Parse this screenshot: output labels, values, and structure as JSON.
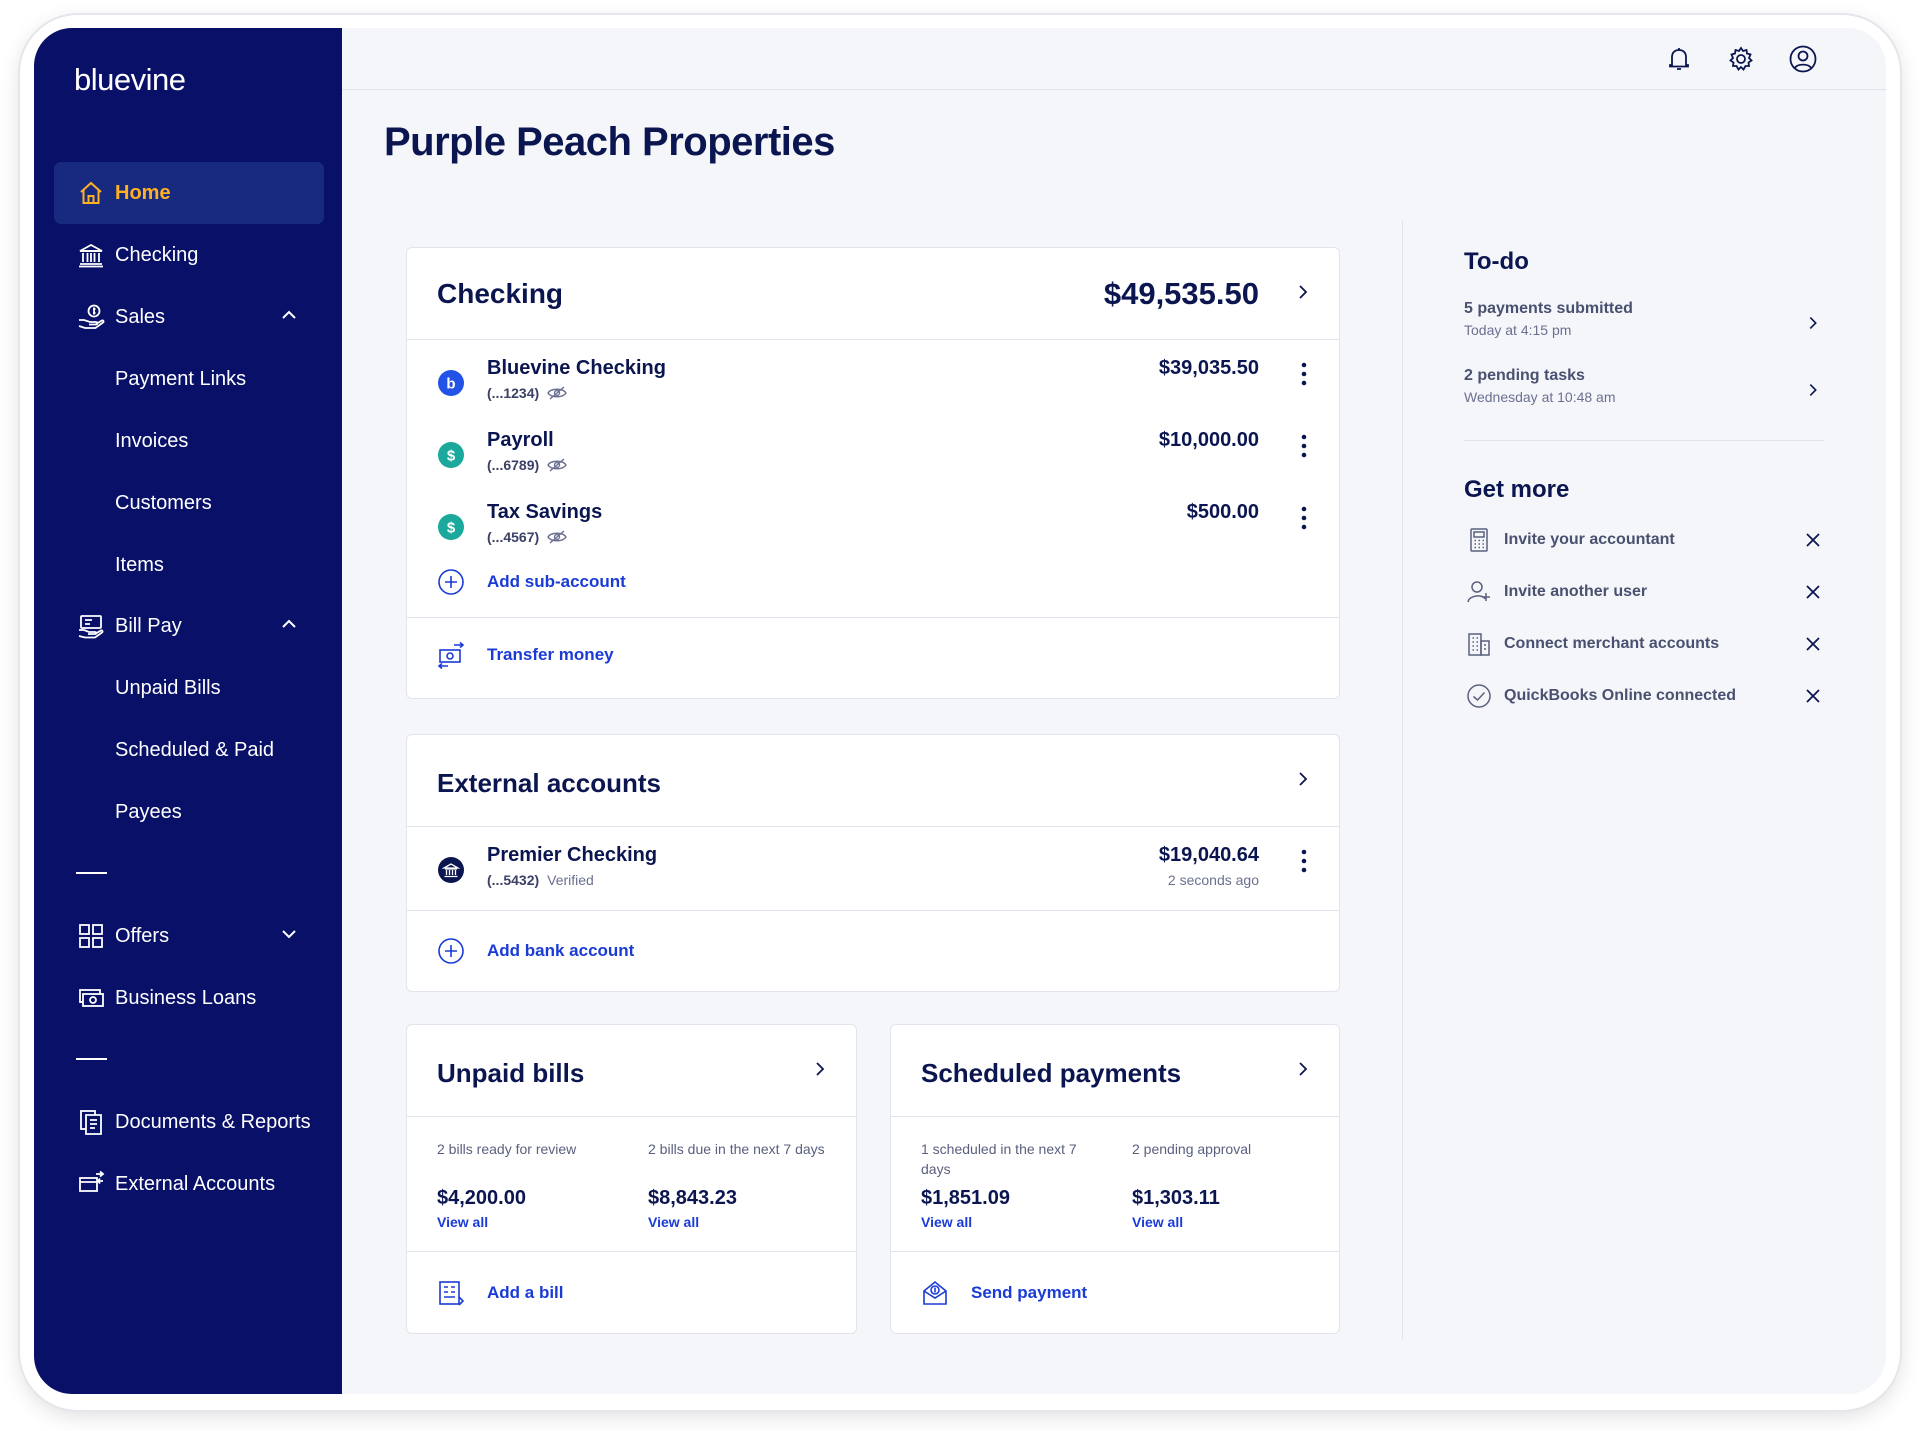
{
  "brand": {
    "logo_text": "bluevine"
  },
  "sidebar": {
    "items": [
      {
        "label": "Home"
      },
      {
        "label": "Checking"
      },
      {
        "label": "Sales"
      },
      {
        "label": "Payment Links"
      },
      {
        "label": "Invoices"
      },
      {
        "label": "Customers"
      },
      {
        "label": "Items"
      },
      {
        "label": "Bill Pay"
      },
      {
        "label": "Unpaid Bills"
      },
      {
        "label": "Scheduled & Paid"
      },
      {
        "label": "Payees"
      },
      {
        "label": "Offers"
      },
      {
        "label": "Business Loans"
      },
      {
        "label": "Documents & Reports"
      },
      {
        "label": "External Accounts"
      }
    ]
  },
  "page": {
    "title": "Purple Peach Properties"
  },
  "checking": {
    "title": "Checking",
    "total": "$49,535.50",
    "accounts": [
      {
        "name": "Bluevine Checking",
        "number": "(...1234)",
        "balance": "$39,035.50"
      },
      {
        "name": "Payroll",
        "number": "(...6789)",
        "balance": "$10,000.00"
      },
      {
        "name": "Tax Savings",
        "number": "(...4567)",
        "balance": "$500.00"
      }
    ],
    "add_sub_account": "Add sub-account",
    "transfer_money": "Transfer money"
  },
  "external": {
    "title": "External accounts",
    "accounts": [
      {
        "name": "Premier Checking",
        "number": "(...5432)",
        "status": "Verified",
        "balance": "$19,040.64",
        "updated": "2 seconds ago"
      }
    ],
    "add_bank_account": "Add bank account"
  },
  "unpaid_bills": {
    "title": "Unpaid bills",
    "stats": [
      {
        "label": "2 bills ready for review",
        "value": "$4,200.00",
        "link": "View all"
      },
      {
        "label": "2 bills due in the next 7 days",
        "value": "$8,843.23",
        "link": "View all"
      }
    ],
    "action": "Add a bill"
  },
  "scheduled_payments": {
    "title": "Scheduled payments",
    "stats": [
      {
        "label": "1 scheduled in the next 7 days",
        "value": "$1,851.09",
        "link": "View all"
      },
      {
        "label": "2 pending approval",
        "value": "$1,303.11",
        "link": "View all"
      }
    ],
    "action": "Send payment"
  },
  "todo": {
    "title": "To-do",
    "items": [
      {
        "title": "5 payments submitted",
        "subtitle": "Today at 4:15 pm"
      },
      {
        "title": "2 pending tasks",
        "subtitle": "Wednesday at 10:48 am"
      }
    ]
  },
  "get_more": {
    "title": "Get more",
    "items": [
      {
        "label": "Invite your accountant",
        "icon": "calculator-icon"
      },
      {
        "label": "Invite another user",
        "icon": "user-add-icon"
      },
      {
        "label": "Connect merchant accounts",
        "icon": "building-icon"
      },
      {
        "label": "QuickBooks Online connected",
        "icon": "check-circle-icon"
      }
    ]
  },
  "colors": {
    "sidebar": "#081068",
    "active_item": "#ffb020",
    "link": "#1a3bd6",
    "text": "#0b1650",
    "teal": "#1aa99a"
  }
}
